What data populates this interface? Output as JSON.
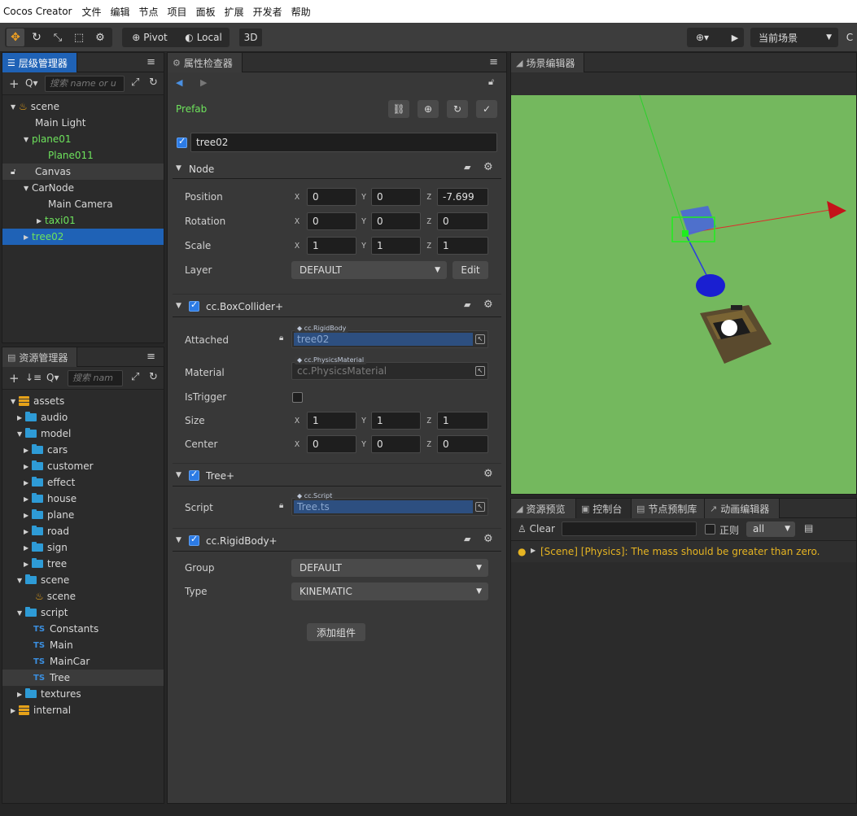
{
  "menu": {
    "app": "Cocos Creator",
    "items": [
      "文件",
      "编辑",
      "节点",
      "项目",
      "面板",
      "扩展",
      "开发者",
      "帮助"
    ]
  },
  "toolbar": {
    "pivot": "Pivot",
    "local": "Local",
    "mode3d": "3D",
    "scene_select": "当前场景"
  },
  "hierarchy": {
    "title": "层级管理器",
    "search_placeholder": "搜索 name or u",
    "nodes": [
      "scene",
      "Main Light",
      "plane01",
      "Plane011",
      "Canvas",
      "CarNode",
      "Main Camera",
      "taxi01",
      "tree02"
    ]
  },
  "assets": {
    "title": "资源管理器",
    "search_placeholder": "搜索 nam",
    "items": [
      "assets",
      "audio",
      "model",
      "cars",
      "customer",
      "effect",
      "house",
      "plane",
      "road",
      "sign",
      "tree",
      "scene",
      "scene",
      "script",
      "Constants",
      "Main",
      "MainCar",
      "Tree",
      "textures",
      "internal"
    ]
  },
  "inspector": {
    "title": "属性检查器",
    "prefab": "Prefab",
    "node_name": "tree02",
    "node_section": "Node",
    "position_label": "Position",
    "rotation_label": "Rotation",
    "scale_label": "Scale",
    "layer_label": "Layer",
    "position": {
      "x": "0",
      "y": "0",
      "z": "-7.699"
    },
    "rotation": {
      "x": "0",
      "y": "0",
      "z": "0"
    },
    "scale": {
      "x": "1",
      "y": "1",
      "z": "1"
    },
    "layer": "DEFAULT",
    "edit_button": "Edit",
    "axes": {
      "x": "X",
      "y": "Y",
      "z": "Z"
    },
    "box_collider": {
      "title": "cc.BoxCollider+",
      "attached_label": "Attached",
      "attached_tag": "cc.RigidBody",
      "attached_value": "tree02",
      "material_label": "Material",
      "material_tag": "cc.PhysicsMaterial",
      "material_value": "cc.PhysicsMaterial",
      "istrigger_label": "IsTrigger",
      "size_label": "Size",
      "center_label": "Center",
      "size": {
        "x": "1",
        "y": "1",
        "z": "1"
      },
      "center": {
        "x": "0",
        "y": "0",
        "z": "0"
      }
    },
    "tree": {
      "title": "Tree+",
      "script_label": "Script",
      "script_tag": "cc.Script",
      "script_value": "Tree.ts"
    },
    "rigid_body": {
      "title": "cc.RigidBody+",
      "group_label": "Group",
      "group": "DEFAULT",
      "type_label": "Type",
      "type": "KINEMATIC"
    },
    "add_component": "添加组件"
  },
  "scene_editor": {
    "title": "场景编辑器"
  },
  "bottom": {
    "tabs": [
      "资源预览",
      "控制台",
      "节点预制库",
      "动画编辑器"
    ],
    "clear": "Clear",
    "regex": "正则",
    "filter": "all",
    "message": "[Scene] [Physics]: The mass should be greater than zero."
  },
  "colors": {
    "accent": "#1f62b6",
    "prefab_green": "#6ee35c",
    "warning": "#e6b422",
    "ground": "#74b85e"
  }
}
